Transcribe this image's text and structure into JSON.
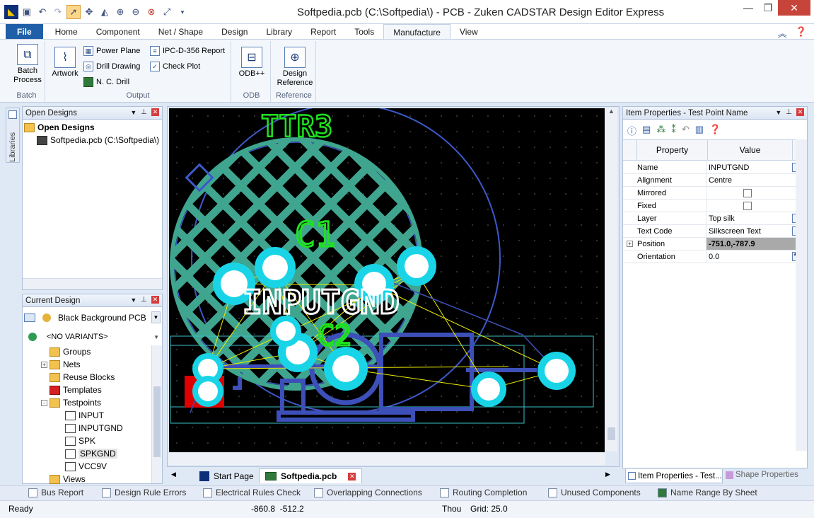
{
  "window": {
    "title": "Softpedia.pcb (C:\\Softpedia\\) - PCB - Zuken CADSTAR Design Editor Express",
    "controls": [
      "minimize",
      "restore",
      "close"
    ]
  },
  "quick_access": [
    "app-icon",
    "save-icon",
    "undo-icon",
    "redo-icon",
    "select-pointer-icon",
    "move-icon",
    "mirror-icon",
    "zoom-in-icon",
    "zoom-out-icon",
    "zoom-area-icon",
    "zoom-fit-icon"
  ],
  "ribbon": {
    "file_label": "File",
    "tabs": [
      "Home",
      "Component",
      "Net / Shape",
      "Design",
      "Library",
      "Report",
      "Tools",
      "Manufacture",
      "View"
    ],
    "active_tab": "Manufacture",
    "groups": {
      "batch": {
        "label": "Batch",
        "button": "Batch\nProcess"
      },
      "output": {
        "label": "Output",
        "artwork": "Artwork",
        "power_plane": "Power Plane",
        "drill_drawing": "Drill Drawing",
        "nc_drill": "N. C. Drill",
        "ipc_report": "IPC-D-356 Report",
        "check_plot": "Check Plot"
      },
      "odb": {
        "label": "ODB",
        "button": "ODB++"
      },
      "reference": {
        "label": "Reference",
        "button": "Design\nReference"
      }
    }
  },
  "libraries_label": "Libraries",
  "open_designs": {
    "title": "Open Designs",
    "root": "Open Designs",
    "item": "Softpedia.pcb (C:\\Softpedia\\)"
  },
  "current_design": {
    "title": "Current Design",
    "background": "Black Background PCB",
    "variant": "<NO VARIANTS>",
    "tree": [
      {
        "label": "Groups",
        "type": "folder",
        "indent": 1
      },
      {
        "label": "Nets",
        "type": "folder",
        "indent": 1,
        "expand": "+"
      },
      {
        "label": "Reuse Blocks",
        "type": "folder",
        "indent": 1
      },
      {
        "label": "Templates",
        "type": "folder-red",
        "indent": 1
      },
      {
        "label": "Testpoints",
        "type": "folder",
        "indent": 1,
        "expand": "-"
      },
      {
        "label": "INPUT",
        "type": "tp",
        "indent": 2
      },
      {
        "label": "INPUTGND",
        "type": "tp",
        "indent": 2
      },
      {
        "label": "SPK",
        "type": "tp",
        "indent": 2
      },
      {
        "label": "SPKGND",
        "type": "tp",
        "indent": 2,
        "selected": true
      },
      {
        "label": "VCC9V",
        "type": "tp",
        "indent": 2
      },
      {
        "label": "Views",
        "type": "folder",
        "indent": 1
      }
    ]
  },
  "pcb": {
    "labels": {
      "top": "TTR3",
      "mid": "C1",
      "text": "INPUTGND",
      "lower": "C2"
    },
    "colors": {
      "hatch": "#3fa58f",
      "board": "#3d59c8",
      "pad": "#19d4e6",
      "silk": "#1ee31e",
      "ratsnest": "#f0f000",
      "bg": "#000000"
    }
  },
  "doc_tabs": [
    {
      "label": "Start Page",
      "active": false
    },
    {
      "label": "Softpedia.pcb",
      "active": true
    }
  ],
  "item_properties": {
    "title": "Item Properties - Test Point Name",
    "toolbar": [
      "info-icon",
      "properties-icon",
      "component-icon",
      "net-icon",
      "undo-icon",
      "export-icon",
      "help-icon"
    ],
    "header_property": "Property",
    "header_value": "Value",
    "rows": [
      {
        "label": "Name",
        "value": "INPUTGND",
        "widget": "edit"
      },
      {
        "label": "Alignment",
        "value": "Centre"
      },
      {
        "label": "Mirrored",
        "value": "",
        "widget": "checkbox"
      },
      {
        "label": "Fixed",
        "value": "",
        "widget": "checkbox"
      },
      {
        "label": "Layer",
        "value": "Top silk",
        "widget": "edit"
      },
      {
        "label": "Text Code",
        "value": "Silkscreen Text",
        "widget": "grid"
      },
      {
        "label": "Position",
        "value": "-751.0,-787.9",
        "highlight": true,
        "expand": "+"
      },
      {
        "label": "Orientation",
        "value": "0.0",
        "widget": "spin"
      }
    ],
    "bottom_tabs": [
      "Item Properties - Test...",
      "Shape Properties"
    ]
  },
  "bottom_tabs": [
    "Bus Report",
    "Design Rule Errors",
    "Electrical Rules Check",
    "Overlapping Connections",
    "Routing Completion",
    "Unused Components",
    "Name Range By Sheet"
  ],
  "status": {
    "ready": "Ready",
    "coords": "-860.8  -512.2",
    "units": "Thou",
    "grid": "Grid: 25.0"
  }
}
